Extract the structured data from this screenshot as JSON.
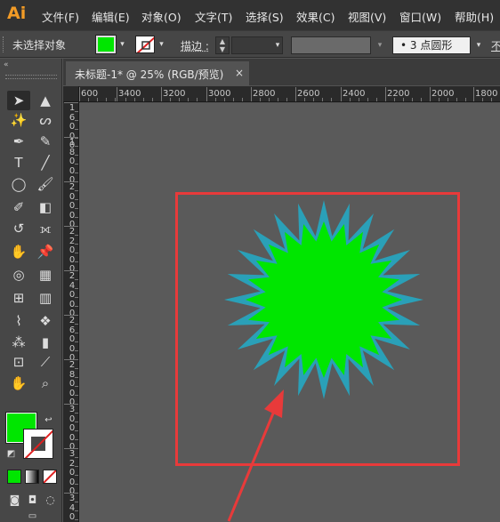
{
  "app": {
    "logo": "Ai",
    "menus": [
      "文件(F)",
      "编辑(E)",
      "对象(O)",
      "文字(T)",
      "选择(S)",
      "效果(C)",
      "视图(V)",
      "窗口(W)",
      "帮助(H)"
    ]
  },
  "controlbar": {
    "selection_status": "未选择对象",
    "stroke_label": "描边 :",
    "brush_value": "3 点圆形",
    "opacity_label": "不",
    "fill_color": "#00e600"
  },
  "document": {
    "tab_title": "未标题-1* @ 25% (RGB/预览)",
    "close_glyph": "×"
  },
  "ruler": {
    "top_labels": [
      "600",
      "3400",
      "3200",
      "3000",
      "2800",
      "2600",
      "2400",
      "2200",
      "2000",
      "1800"
    ],
    "left_labels": [
      "16000",
      "18000",
      "20000",
      "22000",
      "24000",
      "26000",
      "28000",
      "30000",
      "32000",
      "34000"
    ]
  },
  "artwork": {
    "starburst_fill": "#00e600",
    "starburst_stroke": "#2aa0b8",
    "highlight_color": "#e83a3a",
    "arrow_color": "#e83a3a"
  },
  "toolbar": {
    "tools": [
      "selection-tool",
      "direct-selection-tool",
      "magic-wand-tool",
      "lasso-tool",
      "pen-tool",
      "curvature-tool",
      "type-tool",
      "line-segment-tool",
      "ellipse-tool",
      "paintbrush-tool",
      "shaper-tool",
      "eraser-tool",
      "rotate-tool",
      "width-tool",
      "puppet-warp-tool",
      "pin-tool",
      "shape-builder-tool",
      "perspective-grid-tool",
      "mesh-tool",
      "gradient-tool",
      "eyedropper-tool",
      "blend-tool",
      "symbol-sprayer-tool",
      "column-graph-tool",
      "artboard-tool",
      "slice-tool",
      "hand-tool",
      "zoom-tool"
    ]
  }
}
